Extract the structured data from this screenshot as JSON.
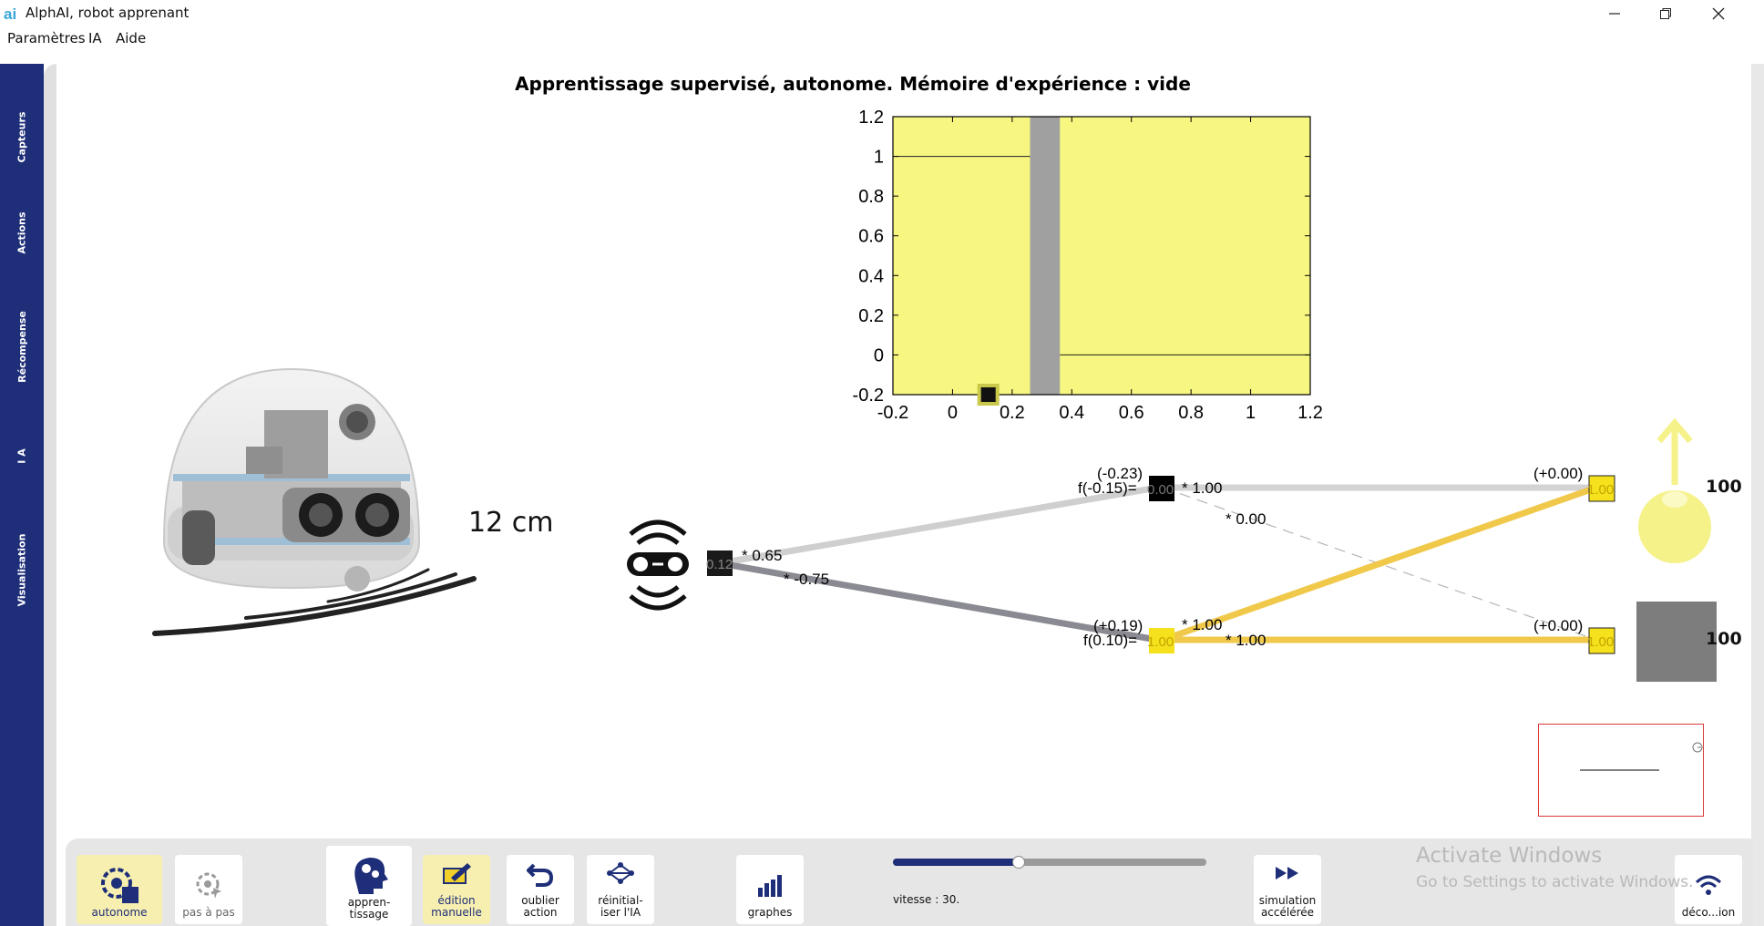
{
  "app": {
    "title": "AlphAI, robot apprenant"
  },
  "menu": {
    "items": [
      "Paramètres",
      "IA",
      "Aide"
    ]
  },
  "sidebar": {
    "tabs": [
      "Capteurs",
      "Actions",
      "Récompense",
      "I A",
      "Visualisation"
    ]
  },
  "main": {
    "title": "Apprentissage supervisé, autonome. Mémoire d'expérience : vide",
    "distance": "12 cm"
  },
  "chart_data": {
    "type": "scatter",
    "x_ticks": [
      "-0.2",
      "0",
      "0.2",
      "0.4",
      "0.6",
      "0.8",
      "1",
      "1.2"
    ],
    "y_ticks": [
      "1.2",
      "1",
      "0.8",
      "0.6",
      "0.4",
      "0.2",
      "0",
      "-0.2"
    ],
    "xlim": [
      -0.2,
      1.2
    ],
    "ylim": [
      -0.2,
      1.2
    ],
    "background_color": "#f6f680",
    "band_x": [
      0.26,
      0.36
    ],
    "band_color": "#a0a0a0",
    "lines": [
      {
        "x": [
          -0.2,
          0.26
        ],
        "y": [
          1,
          1
        ]
      },
      {
        "x": [
          0.36,
          1.2
        ],
        "y": [
          0,
          0
        ]
      }
    ],
    "points": [
      {
        "x": 0.12,
        "y": -0.2
      }
    ]
  },
  "network": {
    "input_value": "0.12",
    "weights": [
      "* 0.65",
      "* -0.75",
      "* 1.00",
      "* 0.00",
      "* 1.00",
      "* 1.00"
    ],
    "hidden": [
      {
        "bias": "(-0.23)",
        "func": "f(-0.15)=",
        "value": "0.00"
      },
      {
        "bias": "(+0.19)",
        "func": "f(0.10)=",
        "value": "1.00"
      }
    ],
    "outputs": [
      {
        "bias": "(+0.00)",
        "value": "1.00",
        "score": "100"
      },
      {
        "bias": "(+0.00)",
        "value": "1.00",
        "score": "100"
      }
    ]
  },
  "toolbar": {
    "autonome": "autonome",
    "pas_a_pas": "pas à pas",
    "apprentissage": "appren-\ntissage",
    "edition": "édition\nmanuelle",
    "oublier": "oublier\naction",
    "reinit": "réinitial-\niser l'IA",
    "graphes": "graphes",
    "simulation": "simulation\naccélérée",
    "deco": "déco...ion"
  },
  "speed": {
    "label": "vitesse : 30.",
    "fraction": 0.4
  },
  "watermark": {
    "line1": "Activate Windows",
    "line2": "Go to Settings to activate Windows."
  },
  "colors": {
    "sidebar": "#1e2e78",
    "accent_yellow": "#f5c518",
    "active_tool": "#f7efb0"
  }
}
